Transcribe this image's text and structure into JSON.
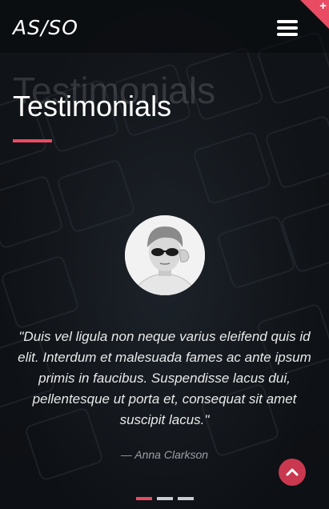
{
  "header": {
    "logo": "AS/SO",
    "menu_icon": "hamburger-menu-icon",
    "corner_icon": "plus-icon"
  },
  "section": {
    "title_ghost": "Testimonials",
    "title": "Testimonials"
  },
  "testimonial": {
    "avatar_icon": "person-with-sunglasses-avatar",
    "quote": "\"Duis vel ligula non neque varius eleifend quis id elit. Interdum et malesuada fames ac ante ipsum primis in faucibus. Suspendisse lacus dui, pellentesque ut porta et, consequat sit amet suscipit lacus.\"",
    "author": "— Anna Clarkson"
  },
  "carousel": {
    "slide_count": 3,
    "active_index": 0
  },
  "scroll_top_icon": "chevron-up-icon",
  "colors": {
    "accent": "#e94b63",
    "scroll_button": "#c9384f",
    "background": "#0c0f13",
    "dot_inactive": "#c9ccd1"
  }
}
